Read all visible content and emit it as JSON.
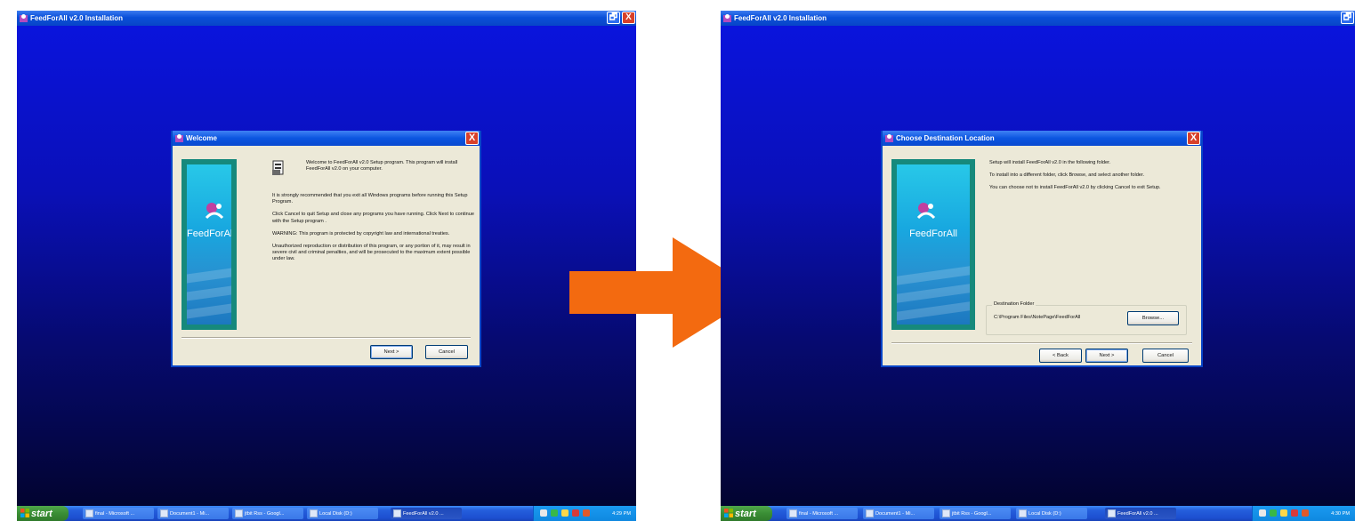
{
  "window_title": "FeedForAll v2.0 Installation",
  "window_controls": {
    "restore": "🗗",
    "close": "X"
  },
  "left": {
    "dialog_title": "Welcome",
    "brand": "FeedForAll",
    "paragraphs": [
      "Welcome to FeedForAll v2.0 Setup program. This program will install FeedForAll v2.0 on your computer.",
      "It is strongly recommended that you exit all Windows programs before running this Setup Program.",
      "Click Cancel to quit Setup and close any programs you have running. Click Next to continue with the Setup program .",
      "WARNING: This program is protected by copyright law and international treaties.",
      "Unauthorized reproduction or distribution of this program, or any portion of it, may result in severe civil and criminal penalties, and will be prosecuted to the maximum extent possible under law."
    ],
    "buttons": {
      "next": "Next >",
      "cancel": "Cancel"
    },
    "clock": "4:29 PM"
  },
  "right": {
    "dialog_title": "Choose Destination Location",
    "brand": "FeedForAll",
    "paragraphs": [
      "Setup will install FeedForAll v2.0 in the following folder.",
      "To install into a different folder, click Browse, and select another folder.",
      "You can choose not to install FeedForAll v2.0 by clicking Cancel to exit Setup."
    ],
    "destination": {
      "legend": "Destination Folder",
      "path": "C:\\Program Files\\NotePage\\FeedForAll",
      "browse": "Browse..."
    },
    "buttons": {
      "back": "< Back",
      "next": "Next >",
      "cancel": "Cancel"
    },
    "clock": "4:30 PM"
  },
  "taskbar": {
    "start": "start",
    "items": [
      "final - Microsoft ...",
      "Document1 - Mi...",
      "jtbit Rss - Googl...",
      "Local Disk (D:)",
      "FeedForAll v2.0 ..."
    ]
  },
  "icons": [
    "app-icon",
    "setup-icon",
    "feed-logo-icon",
    "windows-flag-icon",
    "arrow-right-icon"
  ],
  "colors": {
    "desktop_top": "#0a14e0",
    "desktop_bottom": "#02032a",
    "xp_blue": "#0845c8",
    "dialog_bg": "#ece9d8",
    "arrow": "#f36a10",
    "side_panel": "#16897c"
  }
}
